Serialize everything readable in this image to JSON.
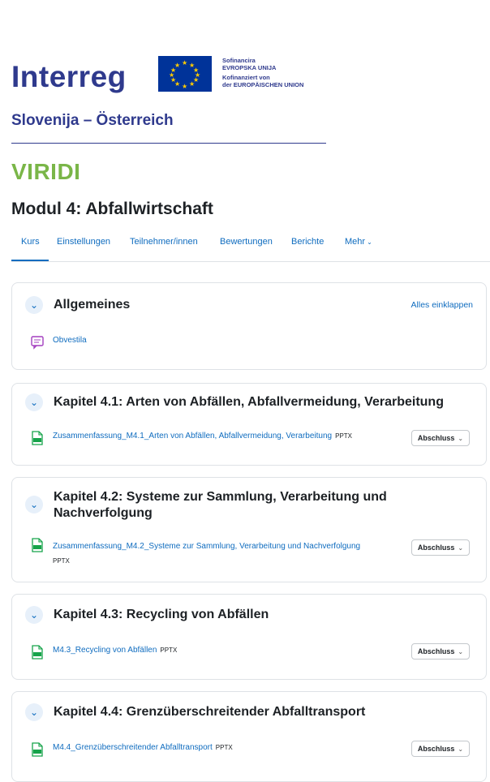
{
  "logo": {
    "brand": "Interreg",
    "eu_lines": [
      "Sofinancira",
      "EVROPSKA UNIJA",
      "Kofinanziert von",
      "der EUROPÄISCHEN UNION"
    ],
    "region": "Slovenija – Österreich"
  },
  "site": {
    "title": "VIRIDI"
  },
  "course": {
    "title": "Modul 4: Abfallwirtschaft"
  },
  "tabs": [
    {
      "label": "Kurs"
    },
    {
      "label": "Einstellungen"
    },
    {
      "label": "Teilnehmer/innen"
    },
    {
      "label": "Bewertungen"
    },
    {
      "label": "Berichte"
    },
    {
      "label": "Mehr"
    }
  ],
  "sections": [
    {
      "title": "Allgemeines",
      "collapse_all": "Alles einklappen",
      "activity": {
        "name": "Obvestila",
        "type": "",
        "icon": "forum-icon"
      }
    },
    {
      "title": "Kapitel 4.1: Arten von Abfällen, Abfallvermeidung, Verarbeitung",
      "activity": {
        "name": "Zusammenfassung_M4.1_Arten von Abfällen, Abfallvermeidung, Verarbeitung",
        "type": "PPTX",
        "icon": "pptx-file-icon"
      },
      "completion": "Abschluss"
    },
    {
      "title": "Kapitel 4.2: Systeme zur Sammlung, Verarbeitung und Nachverfolgung",
      "activity": {
        "name": "Zusammenfassung_M4.2_Systeme zur Sammlung, Verarbeitung und Nachverfolgung",
        "type": "PPTX",
        "icon": "pptx-file-icon"
      },
      "completion": "Abschluss"
    },
    {
      "title": "Kapitel 4.3: Recycling von Abfällen",
      "activity": {
        "name": "M4.3_Recycling von Abfällen",
        "type": "PPTX",
        "icon": "pptx-file-icon"
      },
      "completion": "Abschluss"
    },
    {
      "title": "Kapitel 4.4: Grenzüberschreitender Abfalltransport",
      "activity": {
        "name": "M4.4_Grenzüberschreitender Abfalltransport",
        "type": "PPTX",
        "icon": "pptx-file-icon"
      },
      "completion": "Abschluss"
    }
  ],
  "colors": {
    "accent": "#0f6cbf",
    "brand_blue": "#2f3a8d",
    "brand_green": "#7ab648",
    "eu_blue": "#003399",
    "eu_gold": "#ffcc00"
  }
}
